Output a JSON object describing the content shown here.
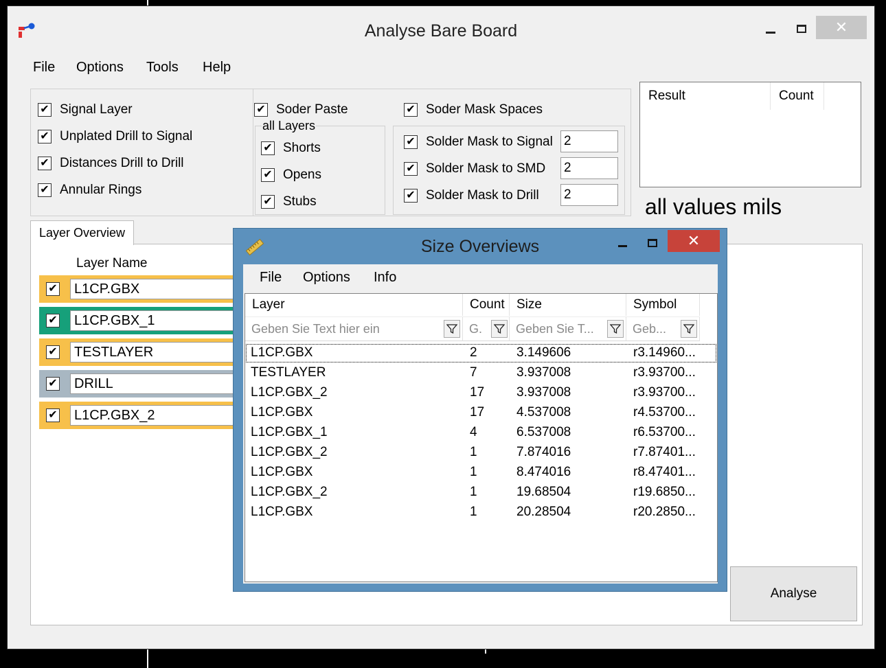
{
  "window": {
    "title": "Analyse Bare Board",
    "close_glyph": "✕"
  },
  "menu": [
    "File",
    "Options",
    "Tools",
    "Help"
  ],
  "check_glyph": "✔",
  "options_left": [
    {
      "label": "Signal Layer",
      "checked": true
    },
    {
      "label": "Unplated Drill to Signal",
      "checked": true
    },
    {
      "label": "Distances Drill to Drill",
      "checked": true
    },
    {
      "label": "Annular Rings",
      "checked": true
    }
  ],
  "solder_paste": {
    "label": "Soder Paste",
    "checked": true
  },
  "all_layers": {
    "title": "all Layers",
    "items": [
      {
        "label": "Shorts",
        "checked": true
      },
      {
        "label": "Opens",
        "checked": true
      },
      {
        "label": "Stubs",
        "checked": true
      }
    ]
  },
  "solder_mask_spaces": {
    "label": "Soder Mask Spaces",
    "checked": true
  },
  "solder_mask": [
    {
      "label": "Solder Mask to Signal",
      "checked": true,
      "value": "2"
    },
    {
      "label": "Solder Mask to SMD",
      "checked": true,
      "value": "2"
    },
    {
      "label": "Solder Mask to Drill",
      "checked": true,
      "value": "2"
    }
  ],
  "result_list": {
    "columns": [
      "Result",
      "Count"
    ]
  },
  "units_note": "all values mils",
  "tab": {
    "label": "Layer Overview"
  },
  "layer_table": {
    "header": "Layer Name",
    "rows": [
      {
        "name": "L1CP.GBX",
        "color": "#f7c04a"
      },
      {
        "name": "L1CP.GBX_1",
        "color": "#16a07a"
      },
      {
        "name": "TESTLAYER",
        "color": "#f7c04a"
      },
      {
        "name": "DRILL",
        "color": "#a8b7c2"
      },
      {
        "name": "L1CP.GBX_2",
        "color": "#f7c04a"
      }
    ]
  },
  "analyse_button": "Analyse",
  "dialog": {
    "title": "Size Overviews",
    "close_glyph": "✕",
    "menu": [
      "File",
      "Options",
      "Info"
    ],
    "columns": [
      "Layer",
      "Count",
      "Size",
      "Symbol"
    ],
    "filter_placeholders": [
      "Geben Sie Text hier ein",
      "G.",
      "Geben Sie T...",
      "Geb..."
    ],
    "rows": [
      {
        "layer": "L1CP.GBX",
        "count": "2",
        "size": "3.149606",
        "symbol": "r3.14960..."
      },
      {
        "layer": "TESTLAYER",
        "count": "7",
        "size": "3.937008",
        "symbol": "r3.93700..."
      },
      {
        "layer": "L1CP.GBX_2",
        "count": "17",
        "size": "3.937008",
        "symbol": "r3.93700..."
      },
      {
        "layer": "L1CP.GBX",
        "count": "17",
        "size": "4.537008",
        "symbol": "r4.53700..."
      },
      {
        "layer": "L1CP.GBX_1",
        "count": "4",
        "size": "6.537008",
        "symbol": "r6.53700..."
      },
      {
        "layer": "L1CP.GBX_2",
        "count": "1",
        "size": "7.874016",
        "symbol": "r7.87401..."
      },
      {
        "layer": "L1CP.GBX",
        "count": "1",
        "size": "8.474016",
        "symbol": "r8.47401..."
      },
      {
        "layer": "L1CP.GBX_2",
        "count": "1",
        "size": "19.68504",
        "symbol": "r19.6850..."
      },
      {
        "layer": "L1CP.GBX",
        "count": "1",
        "size": "20.28504",
        "symbol": "r20.2850..."
      }
    ]
  },
  "icons": {
    "app": "board-app-icon",
    "dialog": "ruler-icon",
    "filter": "filter-icon"
  }
}
